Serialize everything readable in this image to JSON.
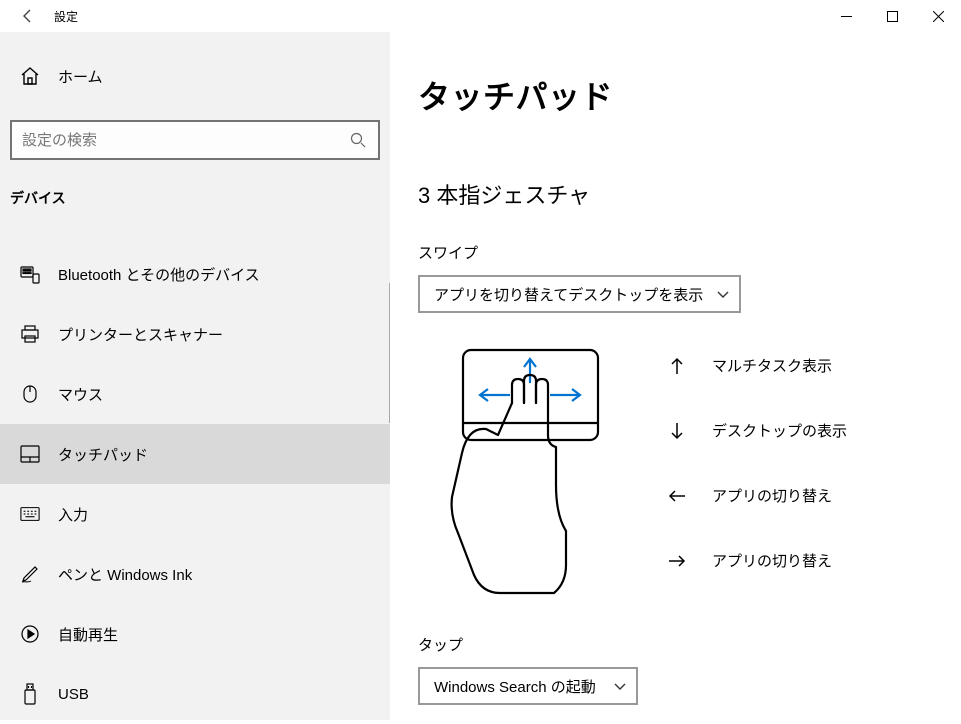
{
  "window": {
    "title": "設定"
  },
  "sidebar": {
    "home": "ホーム",
    "search_placeholder": "設定の検索",
    "category": "デバイス",
    "items": [
      {
        "label": "Bluetooth とその他のデバイス"
      },
      {
        "label": "プリンターとスキャナー"
      },
      {
        "label": "マウス"
      },
      {
        "label": "タッチパッド"
      },
      {
        "label": "入力"
      },
      {
        "label": "ペンと Windows Ink"
      },
      {
        "label": "自動再生"
      },
      {
        "label": "USB"
      }
    ]
  },
  "page": {
    "title": "タッチパッド",
    "section_title": "3 本指ジェスチャ",
    "swipe_label": "スワイプ",
    "swipe_value": "アプリを切り替えてデスクトップを表示",
    "gestures": {
      "up": "マルチタスク表示",
      "down": "デスクトップの表示",
      "left": "アプリの切り替え",
      "right": "アプリの切り替え"
    },
    "tap_label": "タップ",
    "tap_value": "Windows Search の起動"
  }
}
